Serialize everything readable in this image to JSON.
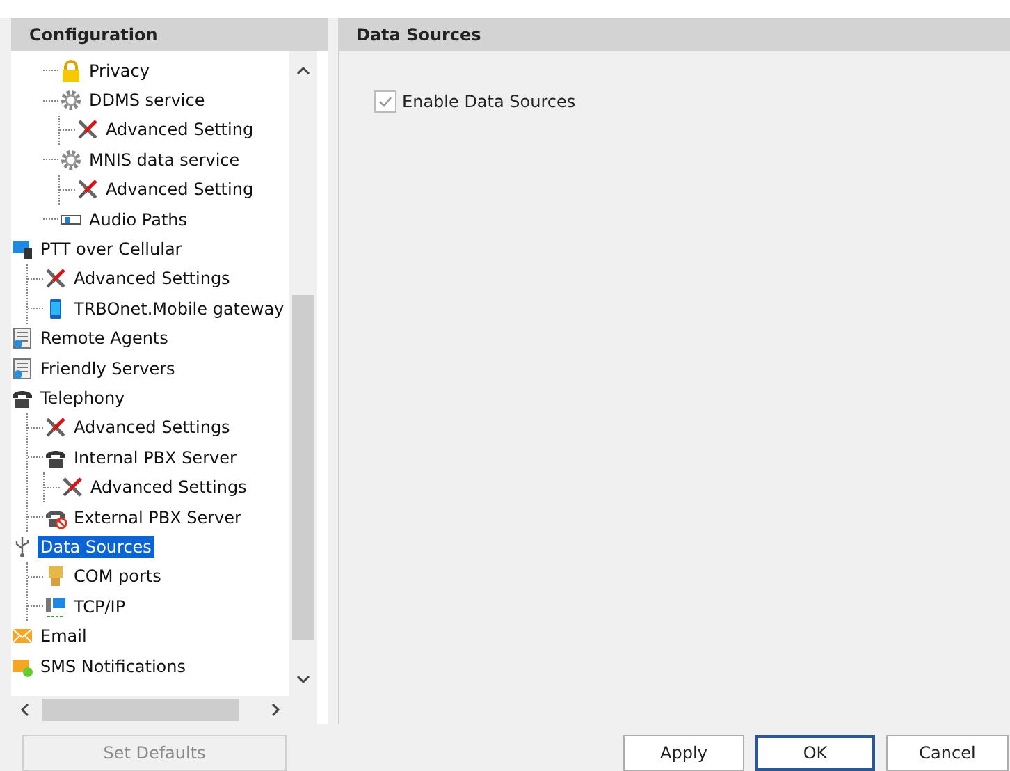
{
  "config_panel": {
    "title": "Configuration"
  },
  "tree": {
    "items": [
      {
        "children": [
          {
            "children": [
              {
                "label": "Privacy",
                "kind": "lock",
                "selected": false
              },
              {
                "label": "DDMS service",
                "kind": "gear",
                "selected": false,
                "children": [
                  {
                    "label": "Advanced Setting",
                    "kind": "tools",
                    "selected": false
                  }
                ]
              },
              {
                "label": "MNIS data service",
                "kind": "gear",
                "selected": false,
                "children": [
                  {
                    "label": "Advanced Setting",
                    "kind": "tools",
                    "selected": false
                  }
                ]
              },
              {
                "label": "Audio Paths",
                "kind": "audio",
                "selected": false
              }
            ]
          }
        ]
      },
      {
        "label": "PTT over Cellular",
        "kind": "monitor",
        "selected": false,
        "children": [
          {
            "label": "Advanced Settings",
            "kind": "tools",
            "selected": false
          },
          {
            "label": "TRBOnet.Mobile gateway",
            "kind": "mobile",
            "selected": false
          }
        ]
      },
      {
        "label": "Remote Agents",
        "kind": "server",
        "selected": false
      },
      {
        "label": "Friendly Servers",
        "kind": "server",
        "selected": false
      },
      {
        "label": "Telephony",
        "kind": "phone",
        "selected": false,
        "children": [
          {
            "label": "Advanced Settings",
            "kind": "tools",
            "selected": false
          },
          {
            "label": "Internal PBX Server",
            "kind": "phone",
            "selected": false,
            "children": [
              {
                "label": "Advanced Settings",
                "kind": "tools",
                "selected": false
              }
            ]
          },
          {
            "label": "External PBX Server",
            "kind": "phone-blocked",
            "selected": false
          }
        ]
      },
      {
        "label": "Data Sources",
        "kind": "usb",
        "selected": true,
        "children": [
          {
            "label": "COM ports",
            "kind": "port",
            "selected": false
          },
          {
            "label": "TCP/IP",
            "kind": "network",
            "selected": false
          }
        ]
      },
      {
        "label": "Email",
        "kind": "mail",
        "selected": false
      },
      {
        "label": "SMS Notifications",
        "kind": "sms",
        "selected": false
      }
    ]
  },
  "set_defaults": {
    "label": "Set Defaults",
    "disabled": true
  },
  "content": {
    "title": "Data Sources",
    "checkbox": {
      "label": "Enable Data Sources",
      "checked": true,
      "disabled": true
    }
  },
  "buttons": [
    {
      "label": "Apply",
      "default": false
    },
    {
      "label": "OK",
      "default": true
    },
    {
      "label": "Cancel",
      "default": false
    }
  ]
}
